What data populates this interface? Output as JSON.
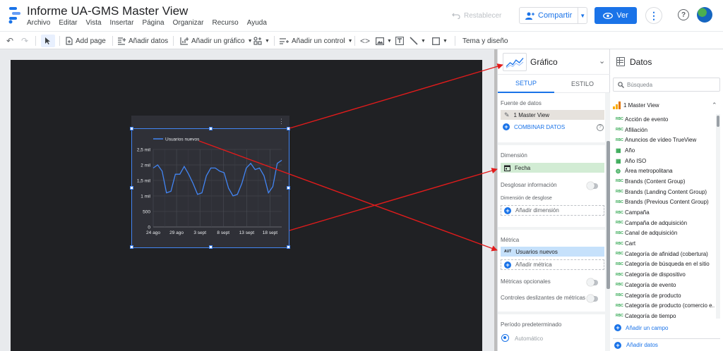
{
  "header": {
    "title": "Informe UA-GMS Master View",
    "menu": [
      "Archivo",
      "Editar",
      "Vista",
      "Insertar",
      "Página",
      "Organizar",
      "Recurso",
      "Ayuda"
    ],
    "reset_label": "Restablecer",
    "share_label": "Compartir",
    "view_label": "Ver"
  },
  "toolbar": {
    "add_page": "Add page",
    "add_data": "Añadir datos",
    "add_chart": "Añadir un gráfico",
    "add_control": "Añadir un control",
    "code_symbol": "<>",
    "theme": "Tema y diseño"
  },
  "chart_data": {
    "type": "line",
    "series": [
      {
        "name": "Usuarios nuevos",
        "values": [
          1900,
          2000,
          1800,
          1100,
          1150,
          1700,
          1700,
          1950,
          1700,
          1400,
          1050,
          1100,
          1650,
          1900,
          1900,
          1800,
          1750,
          1250,
          1000,
          1050,
          1400,
          1900,
          2050,
          1850,
          1900,
          1650,
          1100,
          1300,
          2050,
          2150
        ]
      }
    ],
    "x_tick_labels": [
      "24 ago",
      "29 ago",
      "3 sept",
      "8 sept",
      "13 sept",
      "18 sept"
    ],
    "y_tick_labels": [
      "0",
      "500",
      "1 mil",
      "1,5 mil",
      "2 mil",
      "2,5 mil"
    ],
    "y_ticks": [
      0,
      500,
      1000,
      1500,
      2000,
      2500
    ],
    "ylim": [
      0,
      2500
    ],
    "legend_position": "top-left",
    "grid": true,
    "line_color": "#4285f4"
  },
  "props": {
    "title": "Gráfico",
    "tab_setup": "SETUP",
    "tab_style": "ESTILO",
    "source_label": "Fuente de datos",
    "source_value": "1 Master View",
    "blend_label": "COMBINAR DATOS",
    "dimension_label": "Dimensión",
    "dimension_value": "Fecha",
    "drilldown_label": "Desglosar información",
    "breakdown_label": "Dimensión de desglose",
    "add_dimension": "Añadir dimensión",
    "metric_label": "Métrica",
    "metric_value": "Usuarios nuevos",
    "metric_type": "AUT",
    "add_metric": "Añadir métrica",
    "optional_metrics": "Métricas opcionales",
    "slider_controls": "Controles deslizantes de métricas",
    "default_period": "Período predeterminado",
    "automatic": "Automático"
  },
  "data_panel": {
    "title": "Datos",
    "search_placeholder": "Búsqueda",
    "source": "1 Master View",
    "fields": [
      "Acción de evento",
      "Afiliación",
      "Anuncios de vídeo TrueView",
      "Año",
      "Año ISO",
      "Área metropolitana",
      "Brands (Content Group)",
      "Brands (Landing Content Group)",
      "Brands (Previous Content Group)",
      "Campaña",
      "Campaña de adquisición",
      "Canal de adquisición",
      "Cart",
      "Categoría de afinidad (cobertura)",
      "Categoría de búsqueda en el sitio",
      "Categoría de dispositivo",
      "Categoría de evento",
      "Categoría de producto",
      "Categoría de producto (comercio e...",
      "Categoría de tiempo"
    ],
    "add_field": "Añadir un campo",
    "add_data": "Añadir datos"
  }
}
